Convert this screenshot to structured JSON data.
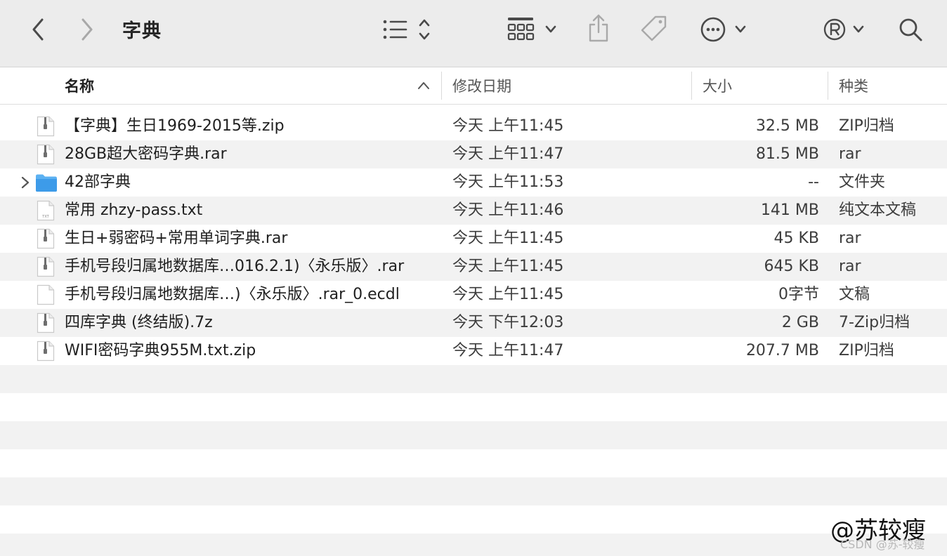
{
  "window": {
    "title": "字典"
  },
  "header": {
    "name": "名称",
    "date": "修改日期",
    "size": "大小",
    "kind": "种类"
  },
  "rows": [
    {
      "name": "【字典】生日1969-2015等.zip",
      "date": "今天 上午11:45",
      "size": "32.5 MB",
      "kind": "ZIP归档",
      "icon": "zip-file-icon"
    },
    {
      "name": "28GB超大密码字典.rar",
      "date": "今天 上午11:47",
      "size": "81.5 MB",
      "kind": "rar",
      "icon": "zip-file-icon"
    },
    {
      "name": "42部字典",
      "date": "今天 上午11:53",
      "size": "--",
      "kind": "文件夹",
      "icon": "folder-icon"
    },
    {
      "name": "常用 zhzy-pass.txt",
      "date": "今天 上午11:46",
      "size": "141 MB",
      "kind": "纯文本文稿",
      "icon": "txt-file-icon"
    },
    {
      "name": "生日+弱密码+常用单词字典.rar",
      "date": "今天 上午11:45",
      "size": "45 KB",
      "kind": "rar",
      "icon": "zip-file-icon"
    },
    {
      "name": "手机号段归属地数据库…016.2.1)〈永乐版〉.rar",
      "date": "今天 上午11:45",
      "size": "645 KB",
      "kind": "rar",
      "icon": "zip-file-icon"
    },
    {
      "name": "手机号段归属地数据库…)〈永乐版〉.rar_0.ecdl",
      "date": "今天 上午11:45",
      "size": "0字节",
      "kind": "文稿",
      "icon": "blank-file-icon"
    },
    {
      "name": "四库字典 (终结版).7z",
      "date": "今天 下午12:03",
      "size": "2 GB",
      "kind": "7-Zip归档",
      "icon": "zip-file-icon"
    },
    {
      "name": "WIFI密码字典955M.txt.zip",
      "date": "今天 上午11:47",
      "size": "207.7 MB",
      "kind": "ZIP归档",
      "icon": "zip-file-icon"
    }
  ],
  "watermark": {
    "main": "@苏较瘦",
    "sub": "CSDN @苏-较瘦"
  },
  "colors": {
    "toolbar_bg": "#ececec",
    "row_alt": "#f2f2f2",
    "folder_blue": "#3d9be9",
    "icon_gray": "#6e6e6e"
  }
}
